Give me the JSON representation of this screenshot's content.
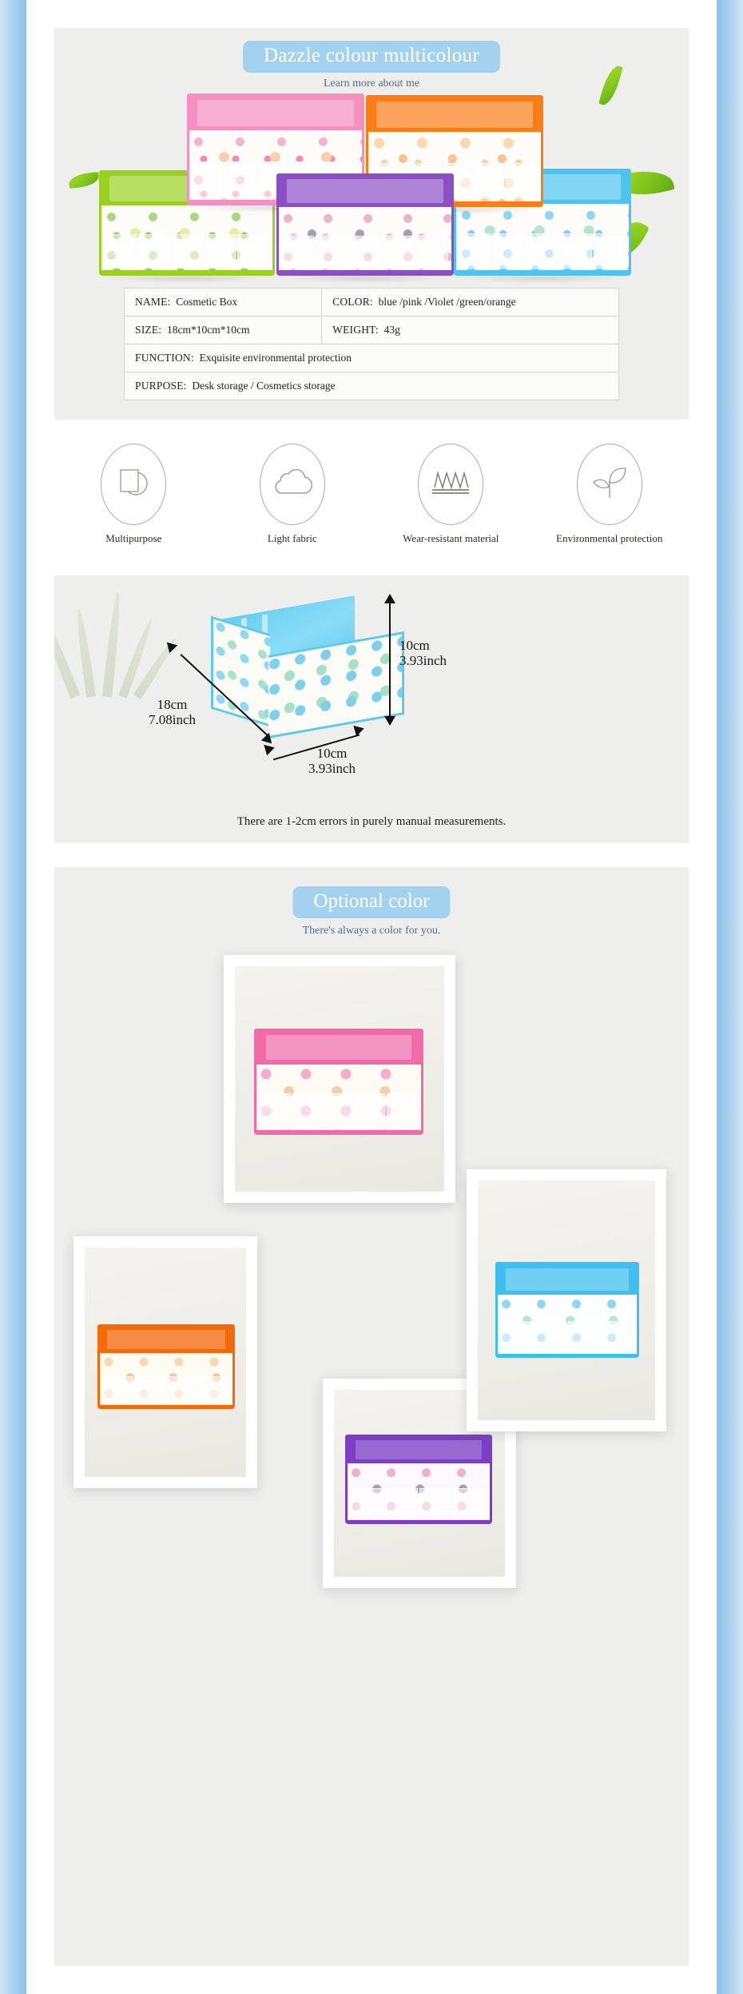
{
  "hero": {
    "title": "Dazzle colour multicolour",
    "subtitle": "Learn more about me",
    "colors": {
      "banner_bg": "#a3d2ee",
      "banner_text": "#ffffff",
      "subtitle": "#4e6e8a"
    },
    "boxes": [
      {
        "name": "pink-box",
        "trim": "#f48fc0"
      },
      {
        "name": "orange-box",
        "trim": "#f97c16"
      },
      {
        "name": "green-box",
        "trim": "#9ad022"
      },
      {
        "name": "violet-box",
        "trim": "#8b4fc4"
      },
      {
        "name": "blue-box",
        "trim": "#4ec3ef"
      }
    ]
  },
  "spec_table": {
    "rows": [
      [
        {
          "label": "NAME:",
          "value": "Cosmetic Box"
        },
        {
          "label": "COLOR:",
          "value": "blue /pink /Violet /green/orange"
        }
      ],
      [
        {
          "label": "SIZE:",
          "value": "18cm*10cm*10cm"
        },
        {
          "label": "WEIGHT:",
          "value": "43g"
        }
      ],
      [
        {
          "label": "FUNCTION:",
          "value": "Exquisite environmental protection"
        }
      ],
      [
        {
          "label": "PURPOSE:",
          "value": "Desk storage / Cosmetics storage"
        }
      ]
    ]
  },
  "features": [
    {
      "icon": "multipurpose-icon",
      "label": "Multipurpose"
    },
    {
      "icon": "cloud-icon",
      "label": "Light fabric"
    },
    {
      "icon": "zigzag-wear-icon",
      "label": "Wear-resistant material"
    },
    {
      "icon": "leaf-eco-icon",
      "label": "Environmental protection"
    }
  ],
  "dimensions": {
    "length": {
      "cm": "18cm",
      "inch": "7.08inch"
    },
    "width": {
      "cm": "10cm",
      "inch": "3.93inch"
    },
    "height": {
      "cm": "10cm",
      "inch": "3.93inch"
    },
    "note": "There are 1-2cm errors in purely manual measurements."
  },
  "optional_color": {
    "title": "Optional color",
    "subtitle": "There's always a color for you.",
    "photos": [
      {
        "name": "pink-swatch-photo",
        "trim": "#f06ba8"
      },
      {
        "name": "orange-swatch-photo",
        "trim": "#f4690a"
      },
      {
        "name": "blue-swatch-photo",
        "trim": "#3fbfee"
      },
      {
        "name": "violet-swatch-photo",
        "trim": "#7a3fc4"
      }
    ]
  }
}
